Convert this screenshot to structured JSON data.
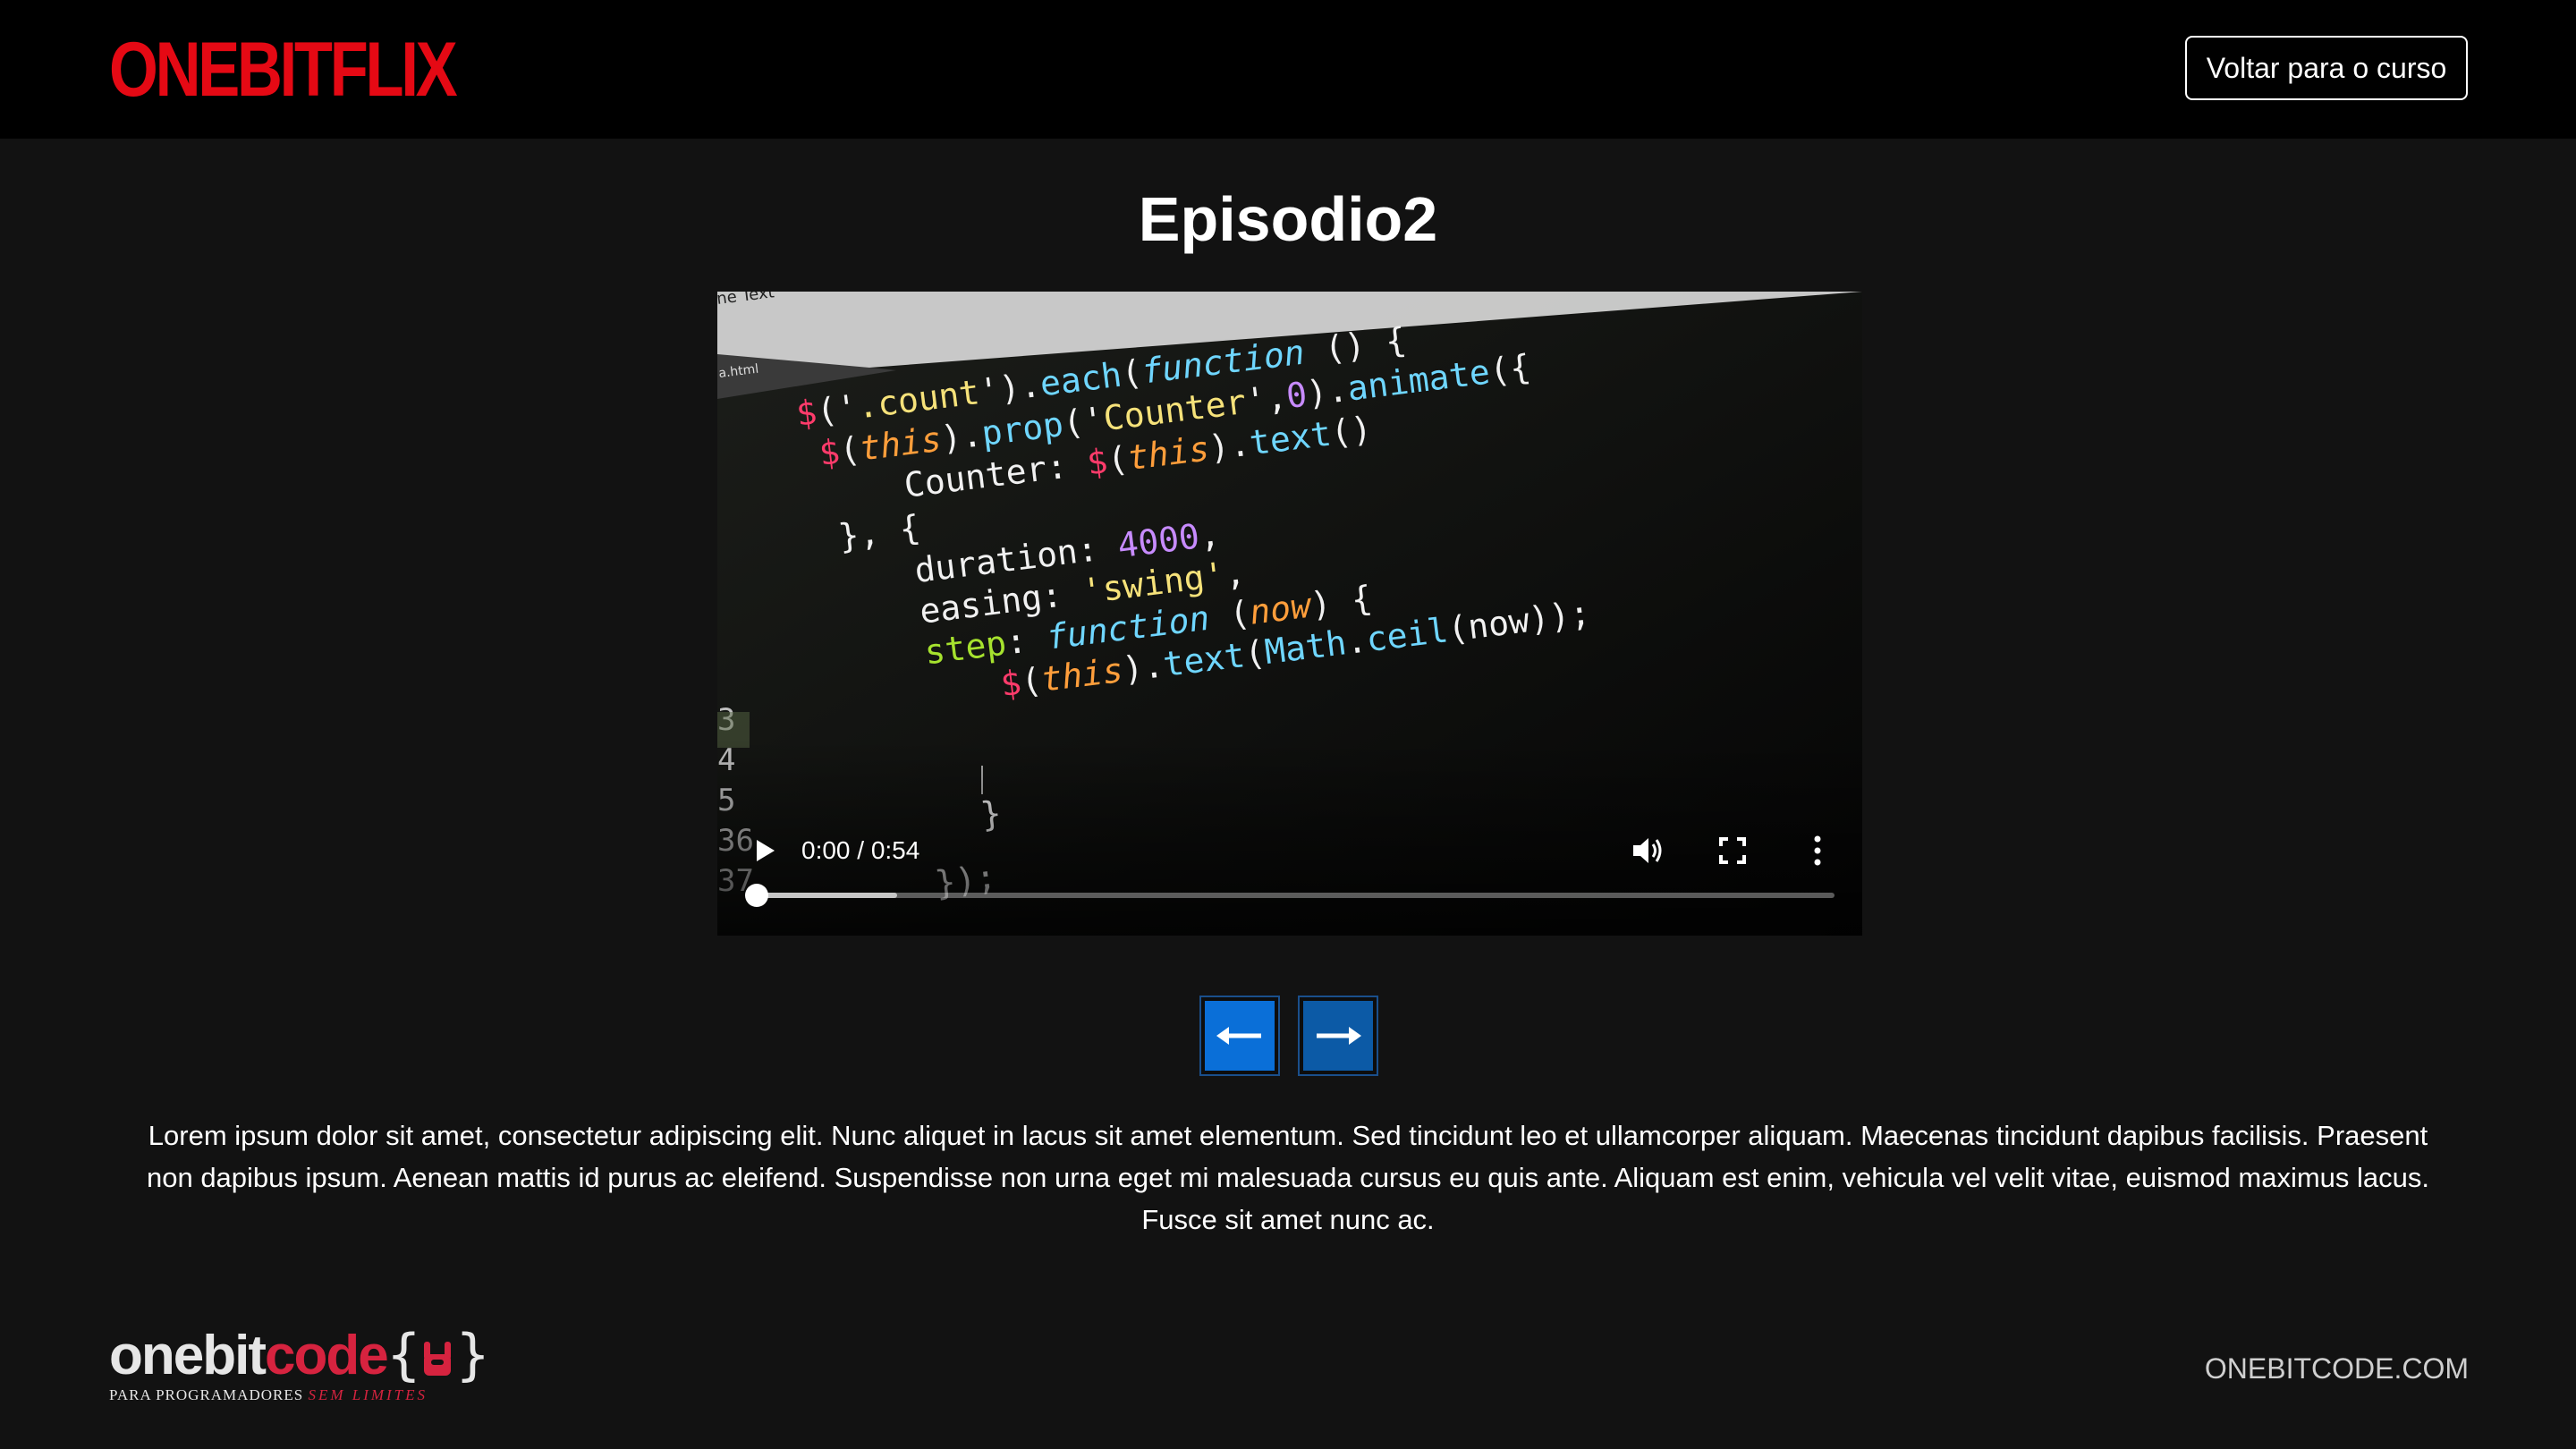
{
  "header": {
    "logo": "ONEBITFLIX",
    "back_button": "Voltar para o curso"
  },
  "episode": {
    "title": "Episodio2"
  },
  "video": {
    "time": "0:00 / 0:54",
    "progress": 0,
    "buffered": 0.13,
    "thumbnail_code": {
      "line_numbers": [
        "3",
        "4",
        "5",
        "36",
        "37"
      ],
      "editor_label": "ne Text",
      "file_label": "a.html"
    }
  },
  "navigation": {
    "prev_icon": "arrow-left-icon",
    "next_icon": "arrow-right-icon"
  },
  "description": "Lorem ipsum dolor sit amet, consectetur adipiscing elit. Nunc aliquet in lacus sit amet elementum. Sed tincidunt leo et ullamcorper aliquam. Maecenas tincidunt dapibus facilisis. Praesent non dapibus ipsum. Aenean mattis id purus ac eleifend. Suspendisse non urna eget mi malesuada cursus eu quis ante. Aliquam est enim, vehicula vel velit vitae, euismod maximus lacus. Fusce sit amet nunc ac.",
  "footer": {
    "logo_one": "onebit",
    "logo_code": "code",
    "logo_braces": "{",
    "logo_braces_close": "}",
    "tagline_a": "PARA PROGRAMADORES",
    "tagline_b": "SEM LIMITES",
    "link": "ONEBITCODE.COM"
  },
  "colors": {
    "brand_red": "#e50914",
    "background": "#121212",
    "header_bg": "#000000",
    "nav_blue": "#0a6fd8"
  }
}
